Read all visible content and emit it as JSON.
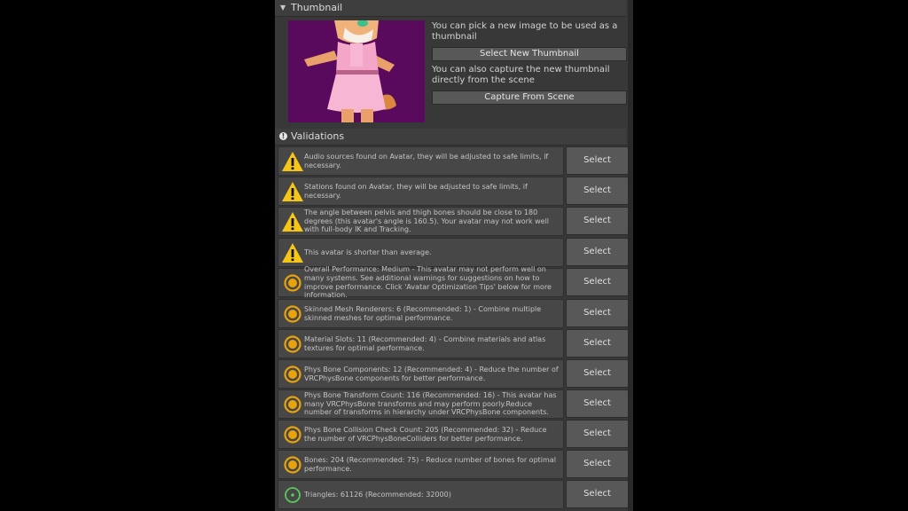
{
  "thumbnail": {
    "section_title": "Thumbnail",
    "pick_text": "You can pick a new image to be used as a thumbnail",
    "select_button": "Select New Thumbnail",
    "capture_text": "You can also capture the new thumbnail directly from the scene",
    "capture_button": "Capture From Scene"
  },
  "validations": {
    "section_title": "Validations",
    "select_label": "Select",
    "rows": [
      {
        "icon": "warning-icon",
        "text": "Audio sources found on Avatar, they will be adjusted to safe limits, if necessary."
      },
      {
        "icon": "warning-icon",
        "text": "Stations found on Avatar, they will be adjusted to safe limits, if necessary."
      },
      {
        "icon": "warning-icon",
        "text": "The angle between pelvis and thigh bones should be close to 180 degrees (this avatar's angle is 160.5). Your avatar may not work well with full-body IK and Tracking."
      },
      {
        "icon": "warning-icon",
        "text": "This avatar is shorter than average."
      },
      {
        "icon": "performance-medium-icon",
        "text": "Overall Performance: Medium - This avatar may not perform well on many systems. See additional warnings for suggestions on how to improve performance. Click 'Avatar Optimization Tips' below for more information."
      },
      {
        "icon": "performance-medium-icon",
        "text": "Skinned Mesh Renderers: 6 (Recommended: 1) - Combine multiple skinned meshes for optimal performance."
      },
      {
        "icon": "performance-medium-icon",
        "text": "Material Slots: 11 (Recommended: 4) - Combine materials and atlas textures for optimal performance."
      },
      {
        "icon": "performance-medium-icon",
        "text": "Phys Bone Components: 12 (Recommended: 4) - Reduce the number of VRCPhysBone components for better performance."
      },
      {
        "icon": "performance-medium-icon",
        "text": "Phys Bone Transform Count: 116 (Recommended: 16) - This avatar has many VRCPhysBone transforms and may perform poorly.Reduce number of transforms in hierarchy under VRCPhysBone components."
      },
      {
        "icon": "performance-medium-icon",
        "text": "Phys Bone Collision Check Count: 205 (Recommended: 32) - Reduce the number of VRCPhysBoneColliders for better performance."
      },
      {
        "icon": "performance-medium-icon",
        "text": "Bones: 204 (Recommended: 75) - Reduce number of bones for optimal performance."
      },
      {
        "icon": "performance-good-icon",
        "text": "Triangles: 61126 (Recommended: 32000)"
      }
    ]
  },
  "colors": {
    "warning": "#f5c518",
    "performance_medium": "#e8a20c",
    "performance_good": "#5ac85a",
    "thumbnail_background": "#5a0a5c"
  }
}
